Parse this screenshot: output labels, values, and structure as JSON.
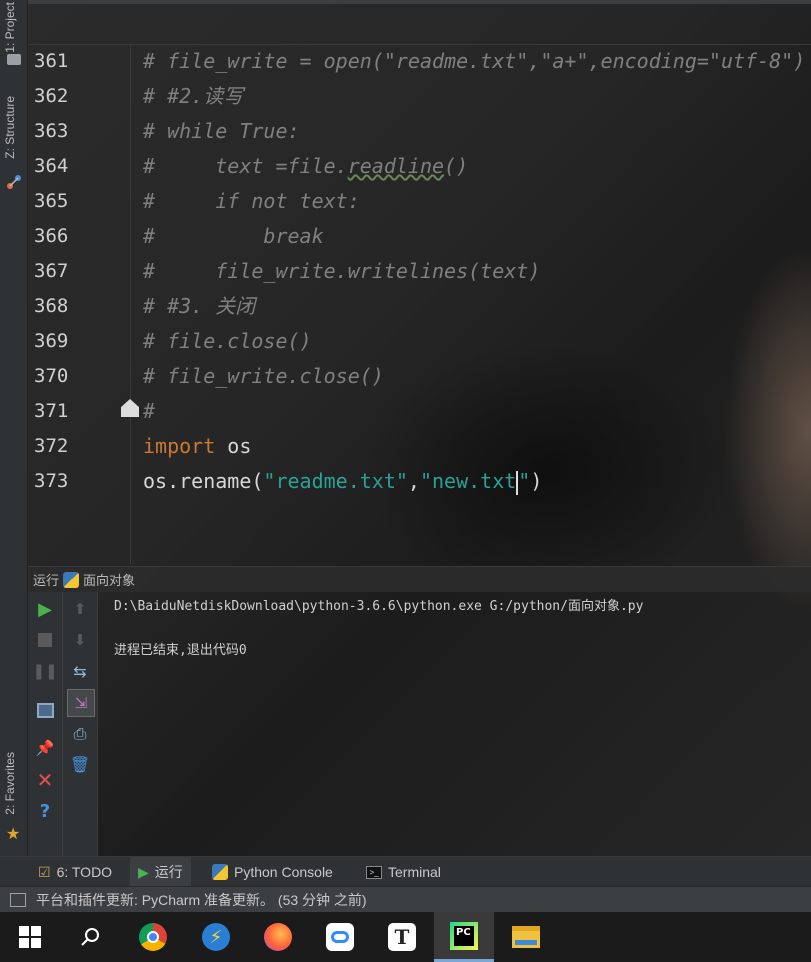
{
  "side_tabs": {
    "project": "1: Project",
    "structure": "Z: Structure",
    "favorites": "2: Favorites"
  },
  "editor": {
    "lines": [
      {
        "num": "361",
        "segments": [
          {
            "cls": "cmt",
            "text": "# file_write = open(\"readme.txt\",\"a+\",encoding=\"utf-8\")"
          }
        ]
      },
      {
        "num": "362",
        "segments": [
          {
            "cls": "cmt",
            "text": "# #2.读写"
          }
        ]
      },
      {
        "num": "363",
        "segments": [
          {
            "cls": "cmt",
            "text": "# while True:"
          }
        ]
      },
      {
        "num": "364",
        "segments": [
          {
            "cls": "cmt",
            "text": "#     text =file."
          },
          {
            "cls": "cmt squig",
            "text": "readline"
          },
          {
            "cls": "cmt",
            "text": "()"
          }
        ]
      },
      {
        "num": "365",
        "segments": [
          {
            "cls": "cmt",
            "text": "#     if not text:"
          }
        ]
      },
      {
        "num": "366",
        "segments": [
          {
            "cls": "cmt",
            "text": "#         break"
          }
        ]
      },
      {
        "num": "367",
        "segments": [
          {
            "cls": "cmt",
            "text": "#     file_write.writelines(text)"
          }
        ]
      },
      {
        "num": "368",
        "segments": [
          {
            "cls": "cmt",
            "text": "# #3. 关闭"
          }
        ]
      },
      {
        "num": "369",
        "segments": [
          {
            "cls": "cmt",
            "text": "# file.close()"
          }
        ]
      },
      {
        "num": "370",
        "segments": [
          {
            "cls": "cmt",
            "text": "# file_write.close()"
          }
        ]
      },
      {
        "num": "371",
        "segments": [
          {
            "cls": "cmt",
            "text": "#"
          }
        ]
      },
      {
        "num": "372",
        "segments": [
          {
            "cls": "kw",
            "text": "import"
          },
          {
            "cls": "plain",
            "text": " os"
          }
        ]
      },
      {
        "num": "373",
        "segments": [
          {
            "cls": "plain",
            "text": "os.rename("
          },
          {
            "cls": "str2",
            "text": "\"readme.txt\""
          },
          {
            "cls": "plain",
            "text": ","
          },
          {
            "cls": "str2",
            "text": "\"new.txt"
          },
          {
            "cls": "caret",
            "text": ""
          },
          {
            "cls": "str2",
            "text": "\""
          },
          {
            "cls": "plain",
            "text": ")"
          }
        ]
      }
    ]
  },
  "run": {
    "header_label": "运行",
    "config_name": "面向对象",
    "output_lines": [
      "D:\\BaiduNetdiskDownload\\python-3.6.6\\python.exe G:/python/面向对象.py",
      "",
      "进程已结束,退出代码0"
    ]
  },
  "bottom_tabs": {
    "todo": "6: TODO",
    "run": "运行",
    "python_console": "Python Console",
    "terminal": "Terminal"
  },
  "status_bar": {
    "message": "平台和插件更新: PyCharm 准备更新。 (53 分钟 之前)"
  },
  "taskbar": {
    "pycharm_label": "PC",
    "typora_label": "T"
  },
  "colors": {
    "comment": "#808080",
    "keyword": "#cc7832",
    "string": "#2aa198",
    "run_green": "#4caf50",
    "stop_red": "#e05050"
  }
}
